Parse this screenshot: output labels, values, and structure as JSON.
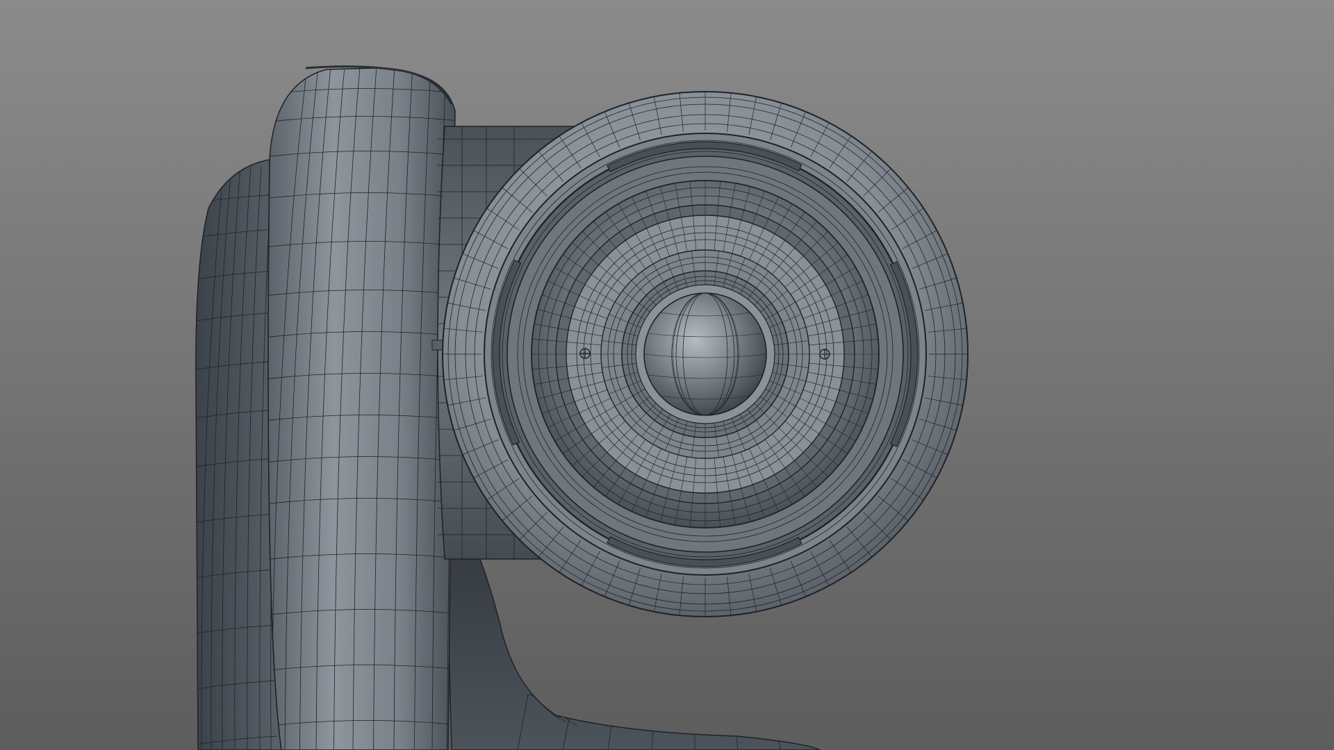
{
  "viewport": {
    "background_top": "#8a8a8a",
    "background_bottom": "#5e5e5e"
  },
  "model": {
    "subject": "ptz-camera-wireframe",
    "shading_light": "#9aa0a6",
    "shading_mid": "#6f767e",
    "shading_dark": "#3e444b",
    "wire_color": "#1e2227"
  },
  "icons": {
    "lens_screw_left": "screw-icon",
    "lens_screw_right": "screw-icon"
  }
}
